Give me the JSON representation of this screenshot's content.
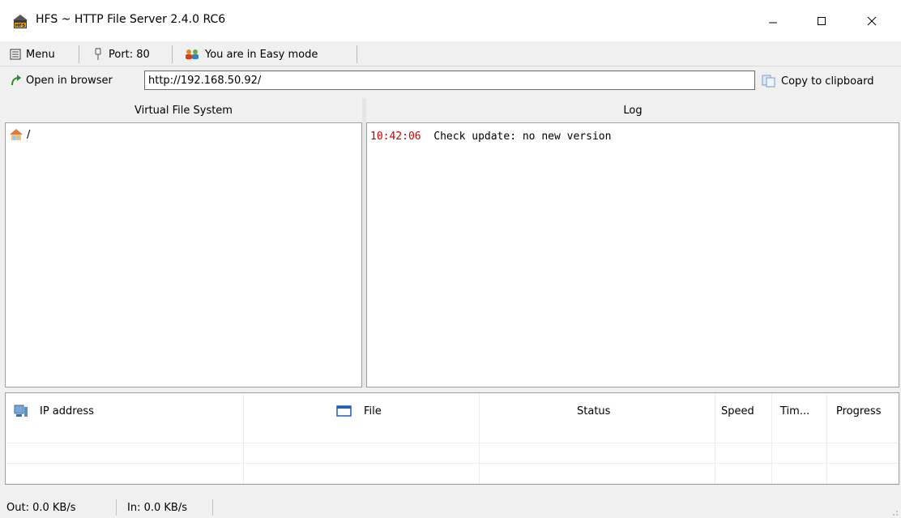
{
  "window": {
    "title": "HFS ~ HTTP File Server 2.4.0 RC6",
    "icon": "hfs-logo-icon",
    "controls": [
      "minimize-icon",
      "maximize-icon",
      "close-icon"
    ]
  },
  "toolbar": {
    "menu_label": "Menu",
    "port_label": "Port: 80",
    "mode_label": "You are in Easy mode"
  },
  "urlbar": {
    "open_label": "Open in browser",
    "url": "http://192.168.50.92/",
    "copy_label": "Copy to clipboard"
  },
  "vfs": {
    "header": "Virtual File System",
    "root_label": "/"
  },
  "log": {
    "header": "Log",
    "entries": [
      {
        "time": "10:42:06",
        "message": "Check update: no new version"
      }
    ]
  },
  "connections": {
    "columns": [
      "IP address",
      "File",
      "Status",
      "Speed",
      "Tim...",
      "Progress"
    ],
    "rows": []
  },
  "statusbar": {
    "out": "Out: 0.0 KB/s",
    "in": "In: 0.0 KB/s"
  },
  "colors": {
    "log_time": "#d00000",
    "window_bg": "#f0f0f0"
  }
}
